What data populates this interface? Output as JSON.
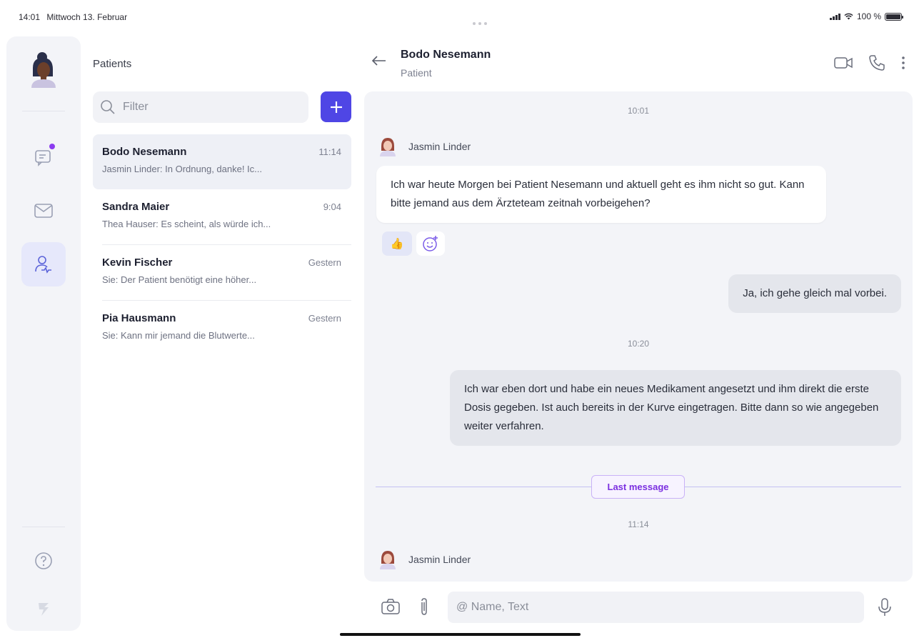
{
  "status_bar": {
    "time": "14:01",
    "date": "Mittwoch 13. Februar",
    "battery": "100 %"
  },
  "nav": {
    "items": [
      {
        "name": "chats",
        "icon": "chat-bubble-icon",
        "unread": true
      },
      {
        "name": "mail",
        "icon": "envelope-icon"
      },
      {
        "name": "patients",
        "icon": "patient-icon",
        "active": true
      },
      {
        "name": "help",
        "icon": "help-icon"
      },
      {
        "name": "logo",
        "icon": "brand-icon"
      }
    ]
  },
  "patients_panel": {
    "title": "Patients",
    "filter_placeholder": "Filter",
    "patients": [
      {
        "name": "Bodo Nesemann",
        "time": "11:14",
        "preview": "Jasmin Linder: In Ordnung, danke! Ic..."
      },
      {
        "name": "Sandra Maier",
        "time": "9:04",
        "preview": "Thea Hauser: Es scheint, als würde ich..."
      },
      {
        "name": "Kevin Fischer",
        "time": "Gestern",
        "preview": "Sie: Der Patient benötigt eine höher..."
      },
      {
        "name": "Pia Hausmann",
        "time": "Gestern",
        "preview": "Sie: Kann mir jemand die Blutwerte..."
      }
    ]
  },
  "chat": {
    "contact_name": "Bodo Nesemann",
    "contact_role": "Patient",
    "messages": {
      "ts1": "10:01",
      "sender1": "Jasmin Linder",
      "msg1": "Ich war heute Morgen bei Patient Nesemann und aktuell geht es ihm nicht so gut. Kann bitte jemand aus dem Ärzteteam zeitnah vorbeigehen?",
      "reaction": "👍",
      "msg2": "Ja, ich gehe gleich mal vorbei.",
      "ts2": "10:20",
      "msg3": "Ich war eben dort und habe ein neues Medikament angesetzt und ihm direkt die erste Dosis gegeben. Ist auch bereits in der Kurve eingetragen. Bitte dann so wie angegeben weiter verfahren.",
      "last_message_label": "Last message",
      "ts3": "11:14",
      "sender2": "Jasmin Linder"
    }
  },
  "composer": {
    "placeholder": "@ Name, Text"
  },
  "colors": {
    "accent": "#4f46e5",
    "unread_dot": "#8b3cf0",
    "rail_active": "#e6e8fb"
  }
}
